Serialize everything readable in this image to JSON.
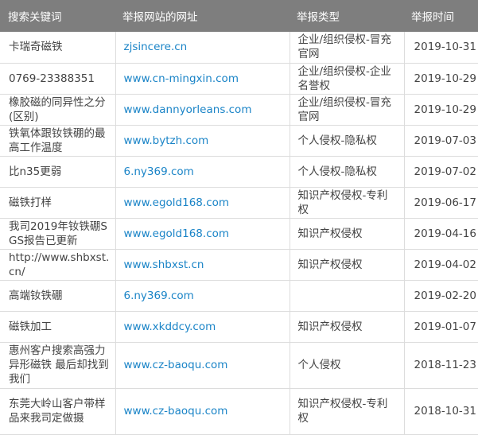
{
  "headers": [
    "搜索关键词",
    "举报网站的网址",
    "举报类型",
    "举报时间"
  ],
  "rows": [
    {
      "keyword": "卡瑞奇磁铁",
      "url": "zjsincere.cn",
      "type": "企业/组织侵权-冒充官网",
      "date": "2019-10-31"
    },
    {
      "keyword": "0769-23388351",
      "url": "www.cn-mingxin.com",
      "type": "企业/组织侵权-企业名誉权",
      "date": "2019-10-29"
    },
    {
      "keyword": "橡胶磁的同异性之分(区别)",
      "url": "www.dannyorleans.com",
      "type": "企业/组织侵权-冒充官网",
      "date": "2019-10-29"
    },
    {
      "keyword": "铁氧体跟钕铁硼的最高工作温度",
      "url": "www.bytzh.com",
      "type": "个人侵权-隐私权",
      "date": "2019-07-03"
    },
    {
      "keyword": "比n35更弱",
      "url": "6.ny369.com",
      "type": "个人侵权-隐私权",
      "date": "2019-07-02"
    },
    {
      "keyword": "磁铁打样",
      "url": "www.egold168.com",
      "type": "知识产权侵权-专利权",
      "date": "2019-06-17"
    },
    {
      "keyword": "我司2019年钕铁硼SGS报告已更新",
      "url": "www.egold168.com",
      "type": "知识产权侵权",
      "date": "2019-04-16"
    },
    {
      "keyword": "http://www.shbxst.cn/",
      "url": "www.shbxst.cn",
      "type": "知识产权侵权",
      "date": "2019-04-02"
    },
    {
      "keyword": "高端钕铁硼",
      "url": "6.ny369.com",
      "type": "",
      "date": "2019-02-20"
    },
    {
      "keyword": "磁铁加工",
      "url": "www.xkddcy.com",
      "type": "知识产权侵权",
      "date": "2019-01-07"
    },
    {
      "keyword": "惠州客户搜索高强力异形磁铁 最后却找到我们",
      "url": "www.cz-baoqu.com",
      "type": "个人侵权",
      "date": "2018-11-23"
    },
    {
      "keyword": "东莞大岭山客户带样品来我司定做摄",
      "url": "www.cz-baoqu.com",
      "type": "知识产权侵权-专利权",
      "date": "2018-10-31"
    }
  ]
}
